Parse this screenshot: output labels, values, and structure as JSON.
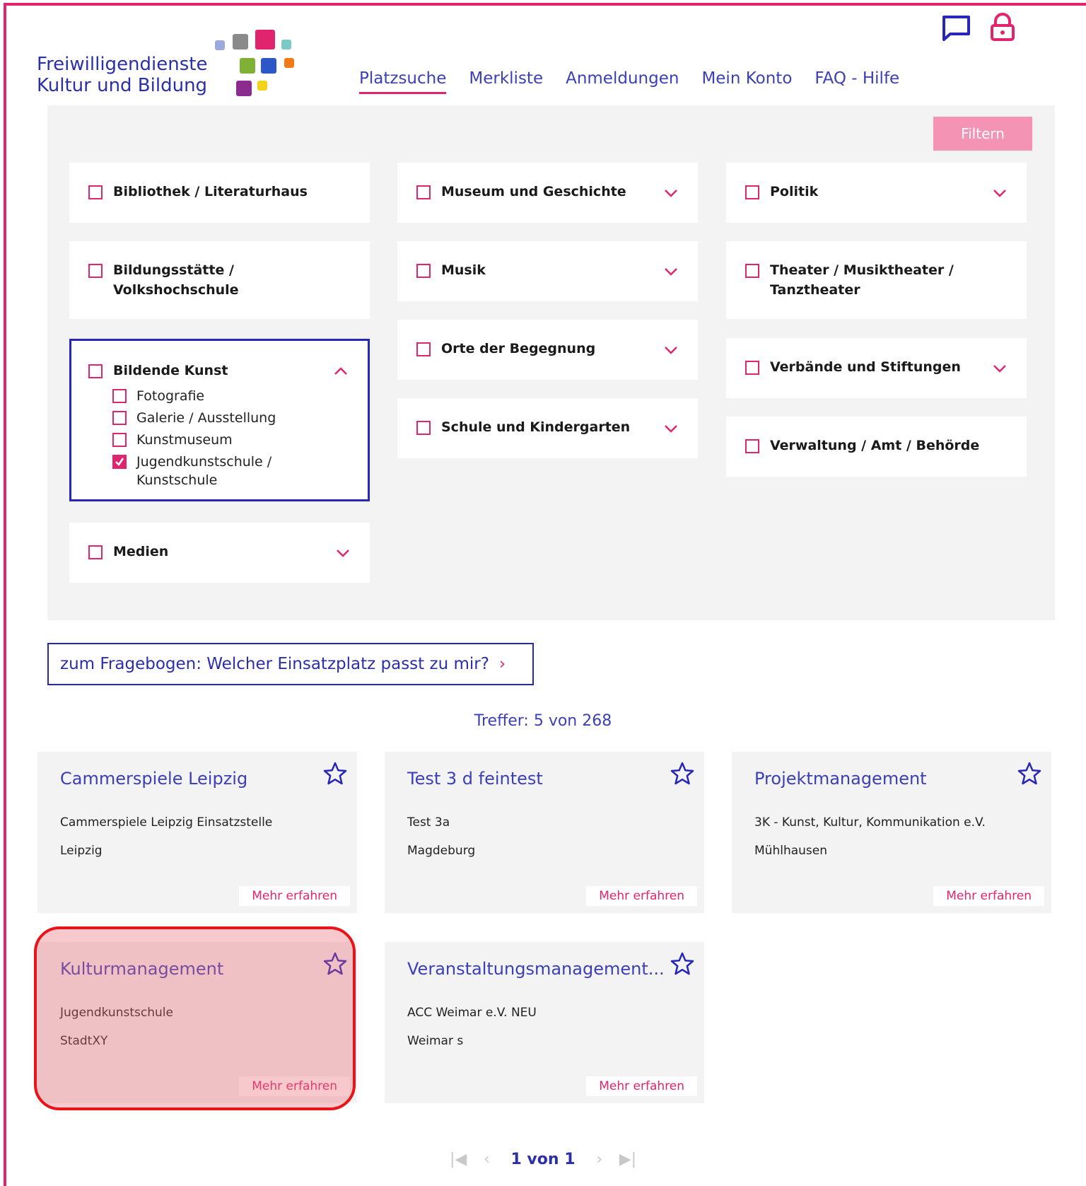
{
  "header": {
    "logo_line1": "Freiwilligendienste",
    "logo_line2": "Kultur und Bildung",
    "icons": [
      "chat-icon",
      "lock-icon"
    ],
    "nav": [
      "Platzsuche",
      "Merkliste",
      "Anmeldungen",
      "Mein Konto",
      "FAQ - Hilfe"
    ],
    "active_nav": "Platzsuche"
  },
  "filter": {
    "button_label": "Filtern",
    "col1": {
      "c1": "Bibliothek / Literaturhaus",
      "c2a": "Bildungsstätte /",
      "c2b": "Volkshochschule",
      "c3": "Bildende Kunst",
      "c3_sub": [
        "Fotografie",
        "Galerie / Ausstellung",
        "Kunstmuseum",
        "Jugendkunstschule /",
        "Kunstschule"
      ],
      "c4": "Medien"
    },
    "col2": {
      "c1": "Museum und Geschichte",
      "c2": "Musik",
      "c3": "Orte der Begegnung",
      "c4": "Schule und Kindergarten"
    },
    "col3": {
      "c1": "Politik",
      "c2a": "Theater / Musiktheater /",
      "c2b": "Tanztheater",
      "c3": "Verbände und Stiftungen",
      "c4": "Verwaltung / Amt / Behörde"
    }
  },
  "quiz_link": "zum Fragebogen: Welcher Einsatzplatz passt zu mir?",
  "quiz_arrow": "›",
  "hits": "Treffer: 5 von 268",
  "results": [
    {
      "title": "Cammerspiele Leipzig",
      "org": "Cammerspiele Leipzig Einsatzstelle",
      "city": "Leipzig",
      "more": "Mehr erfahren"
    },
    {
      "title": "Test 3 d feintest",
      "org": "Test 3a",
      "city": "Magdeburg",
      "more": "Mehr erfahren"
    },
    {
      "title": "Projektmanagement",
      "org": "3K - Kunst, Kultur, Kommunikation e.V.",
      "city": "Mühlhausen",
      "more": "Mehr erfahren"
    },
    {
      "title": "Kulturmanagement",
      "org": "Jugendkunstschule",
      "city": "StadtXY",
      "more": "Mehr erfahren"
    },
    {
      "title": "Veranstaltungsmanagement...",
      "org": "ACC Weimar e.V. NEU",
      "city": "Weimar s",
      "more": "Mehr erfahren"
    }
  ],
  "pager": {
    "first": "|◀",
    "prev": "‹",
    "label": "1 von 1",
    "next": "›",
    "last": "▶|"
  },
  "colors": {
    "accent": "#e0256e",
    "primary": "#2b2fa8",
    "panel_bg": "#f3f3f3",
    "highlight_border": "#e8141a"
  }
}
